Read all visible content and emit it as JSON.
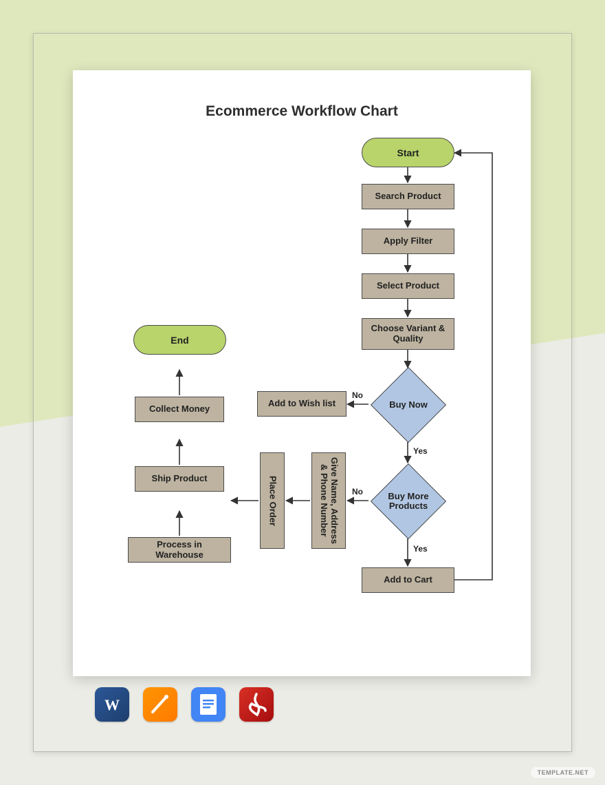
{
  "title": "Ecommerce Workflow Chart",
  "nodes": {
    "start": "Start",
    "search": "Search Product",
    "filter": "Apply Filter",
    "select": "Select Product",
    "variant": "Choose Variant & Quality",
    "buyNow": "Buy Now",
    "buyMore": "Buy More Products",
    "cart": "Add to Cart",
    "wishlist": "Add to Wish list",
    "details": "Give Name, Address & Phone Number",
    "place": "Place Order",
    "warehouse": "Process in Warehouse",
    "ship": "Ship Product",
    "collect": "Collect Money",
    "end": "End"
  },
  "labels": {
    "yes": "Yes",
    "no": "No"
  },
  "icons": [
    "word",
    "pages",
    "gdocs",
    "pdf"
  ],
  "watermark": "TEMPLATE.NET"
}
